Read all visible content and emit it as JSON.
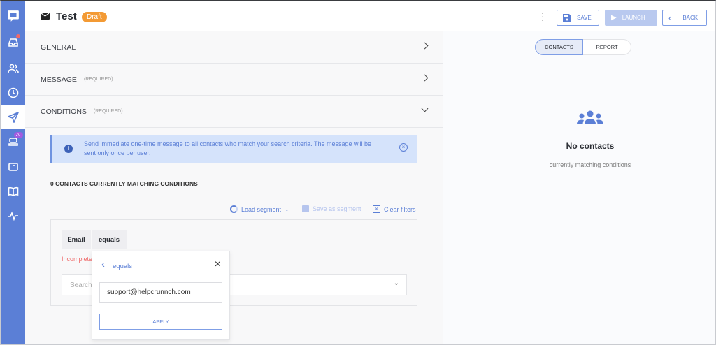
{
  "header": {
    "title": "Test",
    "status": "Draft",
    "save": "SAVE",
    "launch": "LAUNCH",
    "back": "BACK"
  },
  "sections": [
    {
      "label": "GENERAL",
      "note": ""
    },
    {
      "label": "MESSAGE",
      "note": "(REQUIRED)"
    },
    {
      "label": "CONDITIONS",
      "note": "(REQUIRED)"
    }
  ],
  "info": "Send immediate one-time message to all contacts who match your search criteria. The message will be sent only once per user.",
  "count": "0 CONTACTS CURRENTLY MATCHING CONDITIONS",
  "actions": {
    "load": "Load segment",
    "save": "Save as segment",
    "clear": "Clear filters"
  },
  "filter": {
    "field": "Email",
    "operator": "equals",
    "error": "Incomplete",
    "search_placeholder": "Search"
  },
  "popup": {
    "title": "equals",
    "value": "support@helpcrunnch.com",
    "apply": "APPLY"
  },
  "right": {
    "tabs": [
      "CONTACTS",
      "REPORT"
    ],
    "empty_title": "No contacts",
    "empty_sub": "currently matching conditions"
  },
  "sidebar": {
    "ai_badge": "AI"
  }
}
